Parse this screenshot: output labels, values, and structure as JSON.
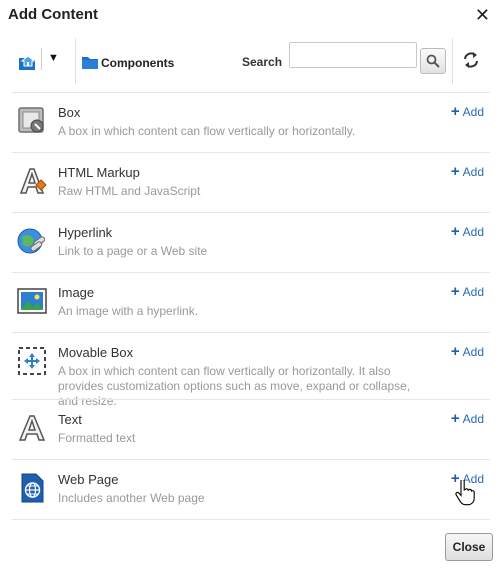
{
  "dialog": {
    "title": "Add Content",
    "close_glyph": "✕"
  },
  "toolbar": {
    "caret": "▼",
    "folder_label": "Components",
    "search_label": "Search",
    "search_value": "",
    "search_placeholder": ""
  },
  "items": [
    {
      "name": "Box",
      "description": "A box in which content can flow vertically or horizontally.",
      "add_label": "Add",
      "icon": "box-icon"
    },
    {
      "name": "HTML Markup",
      "description": "Raw HTML and JavaScript",
      "add_label": "Add",
      "icon": "html-markup-icon"
    },
    {
      "name": "Hyperlink",
      "description": "Link to a page or a Web site",
      "add_label": "Add",
      "icon": "hyperlink-globe-icon"
    },
    {
      "name": "Image",
      "description": "An image with a hyperlink.",
      "add_label": "Add",
      "icon": "image-icon"
    },
    {
      "name": "Movable Box",
      "description": "A box in which content can flow vertically or horizontally. It also provides customization options such as move, expand or collapse, and resize.",
      "add_label": "Add",
      "icon": "movable-box-icon"
    },
    {
      "name": "Text",
      "description": "Formatted text",
      "add_label": "Add",
      "icon": "text-icon"
    },
    {
      "name": "Web Page",
      "description": "Includes another Web page",
      "add_label": "Add",
      "icon": "web-page-icon"
    }
  ],
  "footer": {
    "close_label": "Close"
  },
  "colors": {
    "accent": "#2a6ab2",
    "folder": "#1f6fc9",
    "description": "#999999"
  }
}
